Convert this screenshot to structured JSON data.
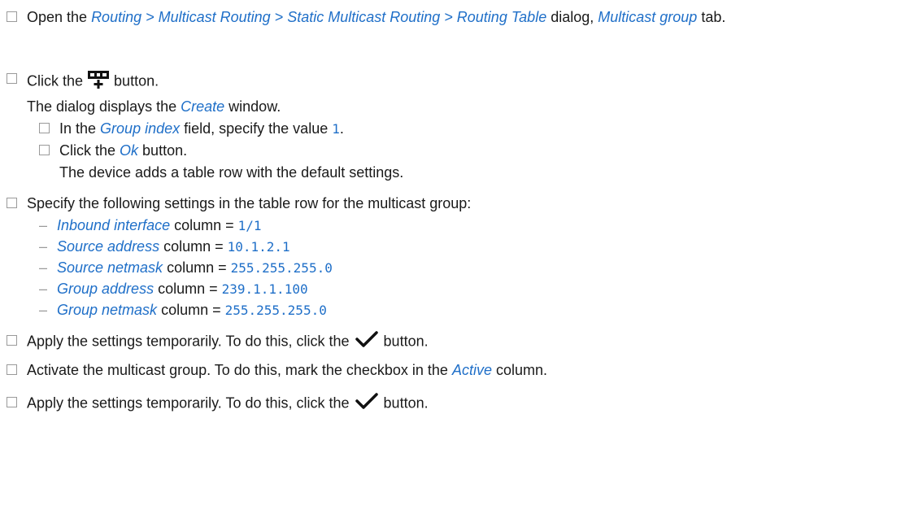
{
  "step1": {
    "a": "Open the ",
    "path": "Routing > Multicast Routing > Static Multicast Routing > Routing Table",
    "b": " dialog, ",
    "tab": "Multicast group",
    "c": " tab."
  },
  "step2": {
    "a": "Click the ",
    "icon": "add-row-icon",
    "b": " button.",
    "result_a": "The dialog displays the ",
    "result_window": "Create",
    "result_b": " window.",
    "sub1_a": "In the ",
    "sub1_field": "Group index",
    "sub1_b": " field, specify the value ",
    "sub1_value": "1",
    "sub1_c": ".",
    "sub2_a": "Click the ",
    "sub2_button": "Ok",
    "sub2_b": " button.",
    "sub2_result": "The device adds a table row with the default settings."
  },
  "step3": {
    "text": "Specify the following settings in the table row for the multicast group:",
    "dash": "–",
    "column_word": " column = ",
    "settings": [
      {
        "column": "Inbound interface",
        "value": "1/1"
      },
      {
        "column": "Source address",
        "value": "10.1.2.1"
      },
      {
        "column": "Source netmask",
        "value": "255.255.255.0"
      },
      {
        "column": "Group address",
        "value": "239.1.1.100"
      },
      {
        "column": "Group netmask",
        "value": "255.255.255.0"
      }
    ]
  },
  "step4": {
    "a": "Apply the settings temporarily. To do this, click the ",
    "icon": "checkmark-icon",
    "b": " button."
  },
  "step5": {
    "a": "Activate the multicast group. To do this, mark the checkbox in the ",
    "column": "Active",
    "b": " column."
  },
  "step6": {
    "a": "Apply the settings temporarily. To do this, click the ",
    "icon": "checkmark-icon",
    "b": " button."
  },
  "colors": {
    "link": "#1f6fc8",
    "text": "#1a1a1a",
    "checkbox": "#9a9a9a"
  }
}
